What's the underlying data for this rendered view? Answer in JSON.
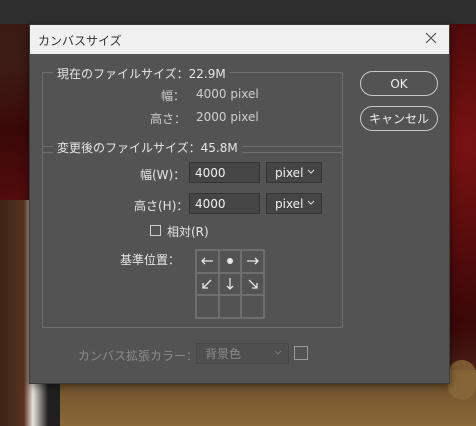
{
  "dialog": {
    "title": "カンバスサイズ",
    "ok_label": "OK",
    "cancel_label": "キャンセル"
  },
  "current": {
    "heading": "現在のファイルサイズ：22.9M",
    "width_label": "幅：",
    "width_value": "4000 pixel",
    "height_label": "高さ：",
    "height_value": "2000 pixel"
  },
  "new_size": {
    "heading": "変更後のファイルサイズ：45.8M",
    "width_label": "幅(W)：",
    "width_value": "4000",
    "width_unit": "pixel",
    "height_label": "高さ(H)：",
    "height_value": "4000",
    "height_unit": "pixel",
    "relative_label": "相対(R)",
    "anchor_label": "基準位置："
  },
  "extension": {
    "label": "カンバス拡張カラー：",
    "value": "背景色"
  },
  "colors": {
    "dialog_bg": "#535353",
    "titlebar_bg": "#f0f0f0",
    "field_bg": "#454545"
  }
}
